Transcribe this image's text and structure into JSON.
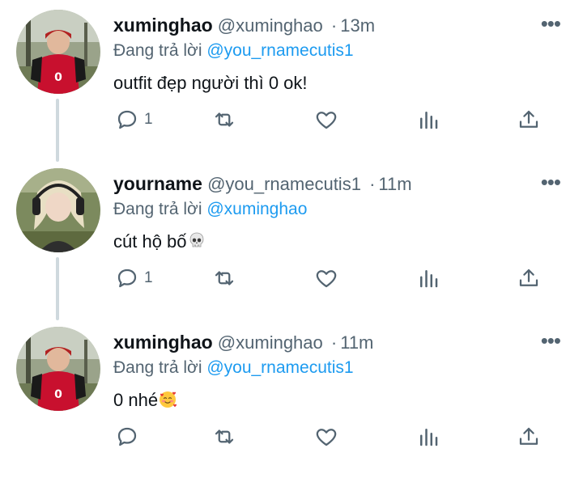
{
  "tweets": [
    {
      "name": "xuminghao",
      "handle": "@xuminghao",
      "separator": "·",
      "time": "13m",
      "reply_prefix": "Đang trả lời",
      "reply_to": "@you_rnamecutis1",
      "text": "outfit đẹp người thì 0 ok!",
      "reply_count": "1",
      "avatar": "red-jersey-avatar"
    },
    {
      "name": "yourname",
      "handle": "@you_rnamecutis1",
      "separator": "·",
      "time": "11m",
      "reply_prefix": "Đang trả lời",
      "reply_to": "@xuminghao",
      "text": "cút hộ bố",
      "emoji": "skull",
      "reply_count": "1",
      "avatar": "blonde-headphones-avatar"
    },
    {
      "name": "xuminghao",
      "handle": "@xuminghao",
      "separator": "·",
      "time": "11m",
      "reply_prefix": "Đang trả lời",
      "reply_to": "@you_rnamecutis1",
      "text": "0 nhé",
      "emoji": "smiling-face-with-hearts",
      "reply_count": "",
      "avatar": "red-jersey-avatar"
    }
  ],
  "more_label": "•••",
  "colors": {
    "text": "#0f1419",
    "muted": "#536471",
    "link": "#1d9bf0",
    "thread_line": "#cfd9de"
  }
}
